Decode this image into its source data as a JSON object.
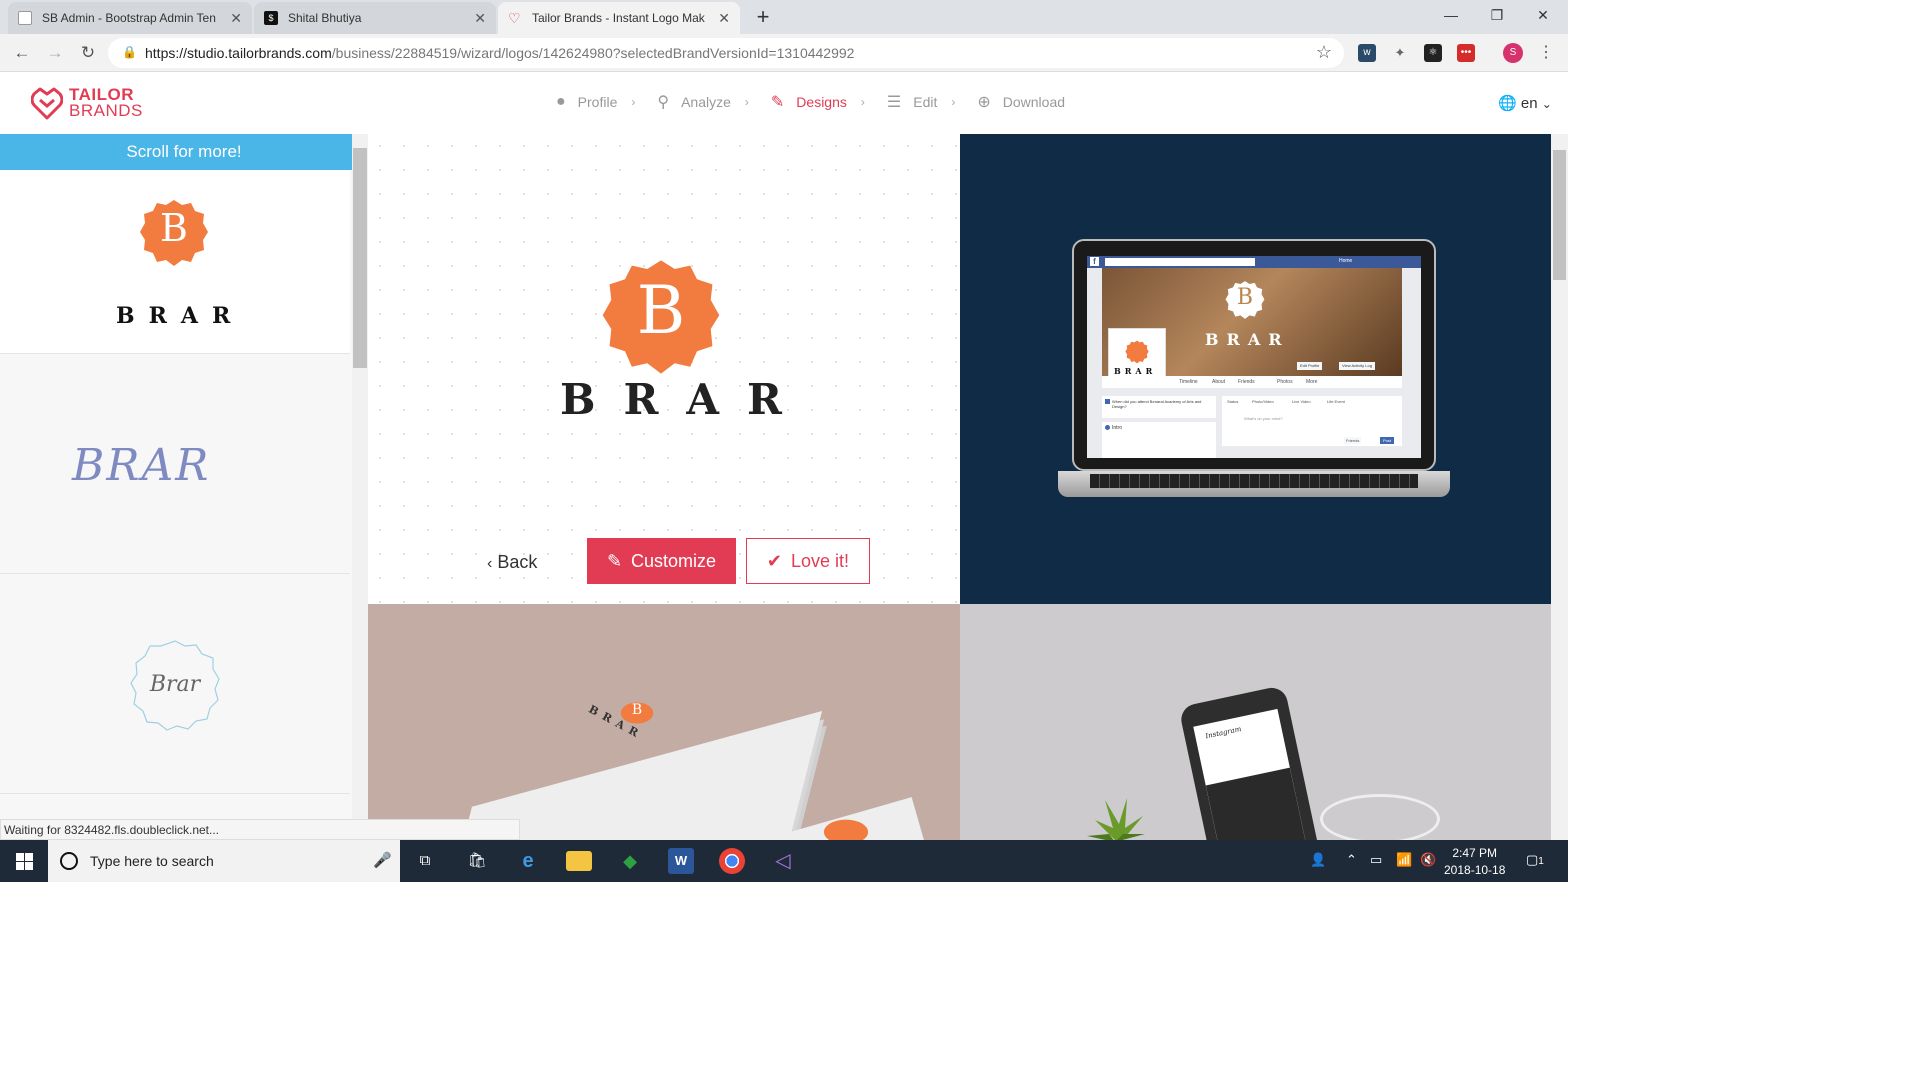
{
  "browser": {
    "tabs": [
      {
        "title": "SB Admin - Bootstrap Admin Ten",
        "active": false
      },
      {
        "title": "Shital Bhutiya",
        "active": false
      },
      {
        "title": "Tailor Brands - Instant Logo Mak",
        "active": true
      }
    ],
    "url_host": "https://studio.tailorbrands.com",
    "url_path": "/business/22884519/wizard/logos/142624980?selectedBrandVersionId=1310442992",
    "profile_initial": "S"
  },
  "site": {
    "logo_line1": "TAILOR",
    "logo_line2": "BRANDS",
    "steps": [
      {
        "label": "Profile",
        "icon": "user-icon"
      },
      {
        "label": "Analyze",
        "icon": "wand-icon"
      },
      {
        "label": "Designs",
        "icon": "pencil-icon",
        "active": true
      },
      {
        "label": "Edit",
        "icon": "sliders-icon"
      },
      {
        "label": "Download",
        "icon": "download-icon"
      }
    ],
    "language": "en",
    "accent": "#e23c54"
  },
  "sidebar": {
    "banner": "Scroll for more!",
    "logos": [
      {
        "mark": "B",
        "wordmark": "BRAR"
      },
      {
        "wordmark": "BRAR"
      },
      {
        "wordmark": "Brar"
      }
    ]
  },
  "preview": {
    "mark": "B",
    "wordmark": "BRAR",
    "back_label": "Back",
    "customize_label": "Customize",
    "love_label": "Love it!"
  },
  "mockups": {
    "laptop": {
      "nav_home": "Home",
      "tabs": [
        "Timeline",
        "About",
        "Friends",
        "Photos",
        "More"
      ],
      "edit_profile": "Edit Profile",
      "view_activity": "View Activity Log",
      "question": "When did you attend Benaral Academy of Arts and Design?",
      "intro": "Intro",
      "post_tabs": [
        "Status",
        "Photo/Video",
        "Live Video",
        "Life Event"
      ],
      "whats_on_mind": "What's on your mind?",
      "friends_btn": "Friends",
      "post_btn": "Post"
    },
    "card_wordmark": "BRAR",
    "phone_app": "Instagram"
  },
  "status_bar": "Waiting for 8324482.fls.doubleclick.net...",
  "taskbar": {
    "search_placeholder": "Type here to search",
    "time": "2:47 PM",
    "date": "2018-10-18",
    "notifications": "1"
  }
}
